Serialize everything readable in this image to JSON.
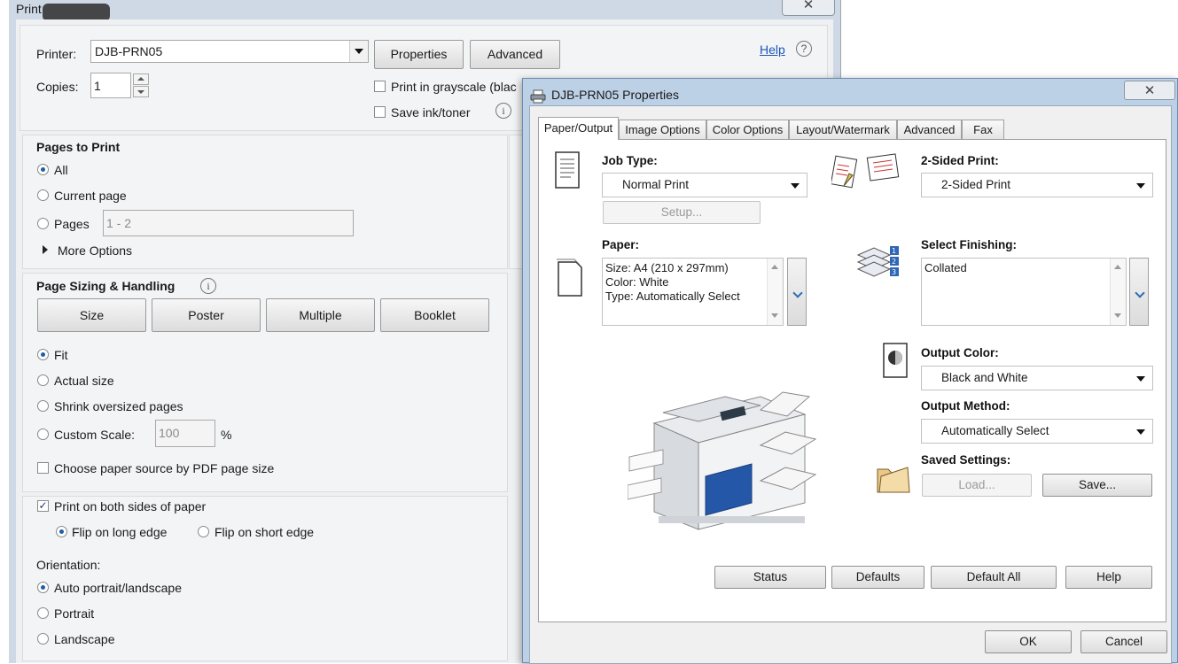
{
  "print_dialog": {
    "title": "Print",
    "close_glyph": "✕",
    "printer_label": "Printer:",
    "printer_value": "DJB-PRN05",
    "properties_button": "Properties",
    "advanced_button": "Advanced",
    "help_link": "Help",
    "copies_label": "Copies:",
    "copies_value": "1",
    "grayscale_label": "Print in grayscale (blac",
    "save_ink_label": "Save ink/toner",
    "pages_to_print": {
      "heading": "Pages to Print",
      "all": "All",
      "current_page": "Current page",
      "pages": "Pages",
      "pages_value": "1 - 2",
      "more_options": "More Options"
    },
    "page_sizing": {
      "heading": "Page Sizing & Handling",
      "size_button": "Size",
      "poster_button": "Poster",
      "multiple_button": "Multiple",
      "booklet_button": "Booklet",
      "fit": "Fit",
      "actual_size": "Actual size",
      "shrink": "Shrink oversized pages",
      "custom_scale": "Custom Scale:",
      "custom_scale_value": "100",
      "percent": "%",
      "paper_source": "Choose paper source by PDF page size"
    },
    "duplex": {
      "both_sides": "Print on both sides of paper",
      "long_edge": "Flip on long edge",
      "short_edge": "Flip on short edge"
    },
    "orientation": {
      "heading": "Orientation:",
      "auto": "Auto portrait/landscape",
      "portrait": "Portrait",
      "landscape": "Landscape"
    }
  },
  "properties_dialog": {
    "title": "DJB-PRN05 Properties",
    "close_glyph": "✕",
    "tabs": [
      "Paper/Output",
      "Image Options",
      "Color Options",
      "Layout/Watermark",
      "Advanced",
      "Fax"
    ],
    "job_type_label": "Job Type:",
    "job_type_value": "Normal Print",
    "setup_button": "Setup...",
    "two_sided_label": "2-Sided Print:",
    "two_sided_value": "2-Sided Print",
    "paper_label": "Paper:",
    "paper_lines": [
      "Size: A4 (210 x 297mm)",
      "Color: White",
      "Type: Automatically Select"
    ],
    "finishing_label": "Select Finishing:",
    "finishing_value": "Collated",
    "output_color_label": "Output Color:",
    "output_color_value": "Black and White",
    "output_method_label": "Output Method:",
    "output_method_value": "Automatically Select",
    "saved_settings_label": "Saved Settings:",
    "load_button": "Load...",
    "save_button": "Save...",
    "status_button": "Status",
    "defaults_button": "Defaults",
    "default_all_button": "Default All",
    "help_button": "Help",
    "ok_button": "OK",
    "cancel_button": "Cancel"
  }
}
